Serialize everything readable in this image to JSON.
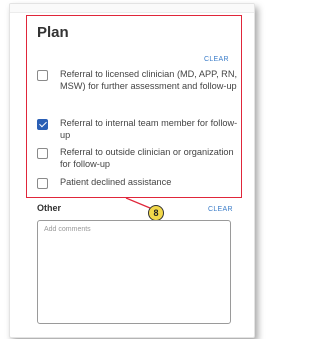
{
  "plan": {
    "title": "Plan",
    "clear_label": "CLEAR",
    "options": [
      {
        "label": "Referral to licensed clinician (MD, APP, RN, MSW) for further assessment and follow-up",
        "checked": false
      },
      {
        "label": "Referral to internal team member for follow-up",
        "checked": true
      },
      {
        "label": "Referral to outside clinician or organization for follow-up",
        "checked": false
      },
      {
        "label": "Patient declined assistance",
        "checked": false
      }
    ]
  },
  "callout": {
    "number": "8",
    "color": "#e0263a",
    "badge_color": "#f2d84a"
  },
  "other": {
    "label": "Other",
    "clear_label": "CLEAR",
    "placeholder": "Add comments"
  },
  "colors": {
    "accent": "#2a5fb5",
    "link": "#3b7dc9"
  }
}
